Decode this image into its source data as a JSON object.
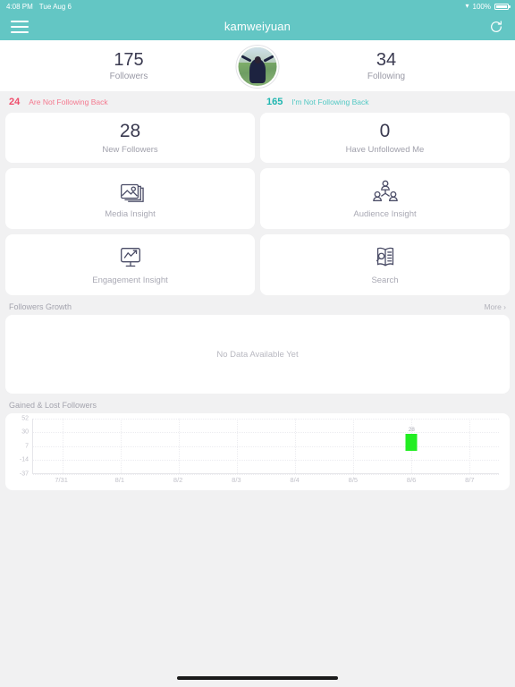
{
  "status_bar": {
    "time": "4:08 PM",
    "date": "Tue Aug 6",
    "battery_percent": "100%",
    "wifi_icon": "wifi-icon",
    "battery_icon": "battery-icon"
  },
  "nav": {
    "menu_icon": "hamburger-menu-icon",
    "title": "kamweiyuan",
    "refresh_icon": "refresh-icon"
  },
  "header_stats": {
    "followers": {
      "value": "175",
      "label": "Followers"
    },
    "following": {
      "value": "34",
      "label": "Following"
    },
    "avatar": "profile-avatar"
  },
  "follow_back": [
    {
      "count": "24",
      "label": "Are Not Following Back",
      "color": "#ef4d6b",
      "name": "not-following-back"
    },
    {
      "count": "165",
      "label": "I'm Not Following Back",
      "color": "#1fb6b0",
      "name": "im-not-following-back"
    }
  ],
  "stat_cards": [
    {
      "value": "28",
      "label": "New Followers",
      "name": "new-followers"
    },
    {
      "value": "0",
      "label": "Have Unfollowed Me",
      "name": "have-unfollowed-me"
    }
  ],
  "insight_cards": [
    {
      "label": "Media Insight",
      "icon": "media-insight-icon",
      "name": "media-insight"
    },
    {
      "label": "Audience Insight",
      "icon": "audience-insight-icon",
      "name": "audience-insight"
    },
    {
      "label": "Engagement Insight",
      "icon": "engagement-insight-icon",
      "name": "engagement-insight"
    },
    {
      "label": "Search",
      "icon": "search-book-icon",
      "name": "search"
    }
  ],
  "followers_growth": {
    "title": "Followers Growth",
    "more_label": "More ›",
    "empty_message": "No Data Available Yet"
  },
  "gained_lost": {
    "title": "Gained & Lost Followers"
  },
  "chart_data": {
    "type": "bar",
    "title": "Gained & Lost Followers",
    "categories": [
      "7/31",
      "8/1",
      "8/2",
      "8/3",
      "8/4",
      "8/5",
      "8/6",
      "8/7"
    ],
    "values": [
      0,
      0,
      0,
      0,
      0,
      0,
      28,
      0
    ],
    "data_labels": [
      "",
      "",
      "",
      "",
      "",
      "",
      "28",
      ""
    ],
    "xlabel": "",
    "ylabel": "",
    "ylim": [
      -37,
      52
    ],
    "yticks": [
      52,
      30,
      7,
      -14,
      -37
    ],
    "grid": true,
    "legend": false,
    "bar_color": "#22ee22",
    "baseline": 0
  }
}
